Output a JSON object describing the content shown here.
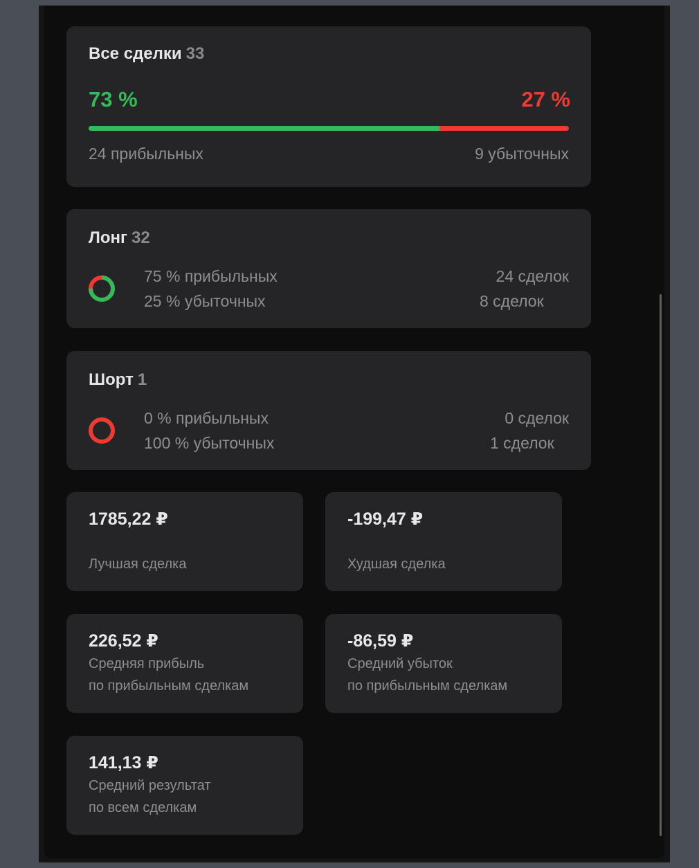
{
  "all_deals": {
    "title": "Все сделки",
    "count": "33",
    "profit_pct_label": "73 %",
    "loss_pct_label": "27 %",
    "profit_fraction": 0.73,
    "profit_label": "24 прибыльных",
    "loss_label": "9 убыточных",
    "colors": {
      "profit": "#33bb5a",
      "loss": "#ee3b32"
    }
  },
  "long": {
    "title": "Лонг",
    "count": "32",
    "profit_line": "75 % прибыльных",
    "loss_line": "25 % убыточных",
    "profit_deals": "24 сделок",
    "loss_deals": "8 сделок",
    "profit_fraction": 0.75,
    "icon": "donut-chart-icon"
  },
  "short": {
    "title": "Шорт",
    "count": "1",
    "profit_line": "0 % прибыльных",
    "loss_line": "100 % убыточных",
    "profit_deals": "0 сделок",
    "loss_deals": "1 сделок",
    "profit_fraction": 0.0,
    "icon": "donut-chart-icon"
  },
  "stats": {
    "best": {
      "value": "1785,22 ₽",
      "label": "Лучшая сделка"
    },
    "worst": {
      "value": "-199,47 ₽",
      "label": "Худшая сделка"
    },
    "avg_profit": {
      "value": "226,52 ₽",
      "label1": "Средняя прибыль",
      "label2": "по прибыльным сделкам"
    },
    "avg_loss": {
      "value": "-86,59 ₽",
      "label1": "Средний убыток",
      "label2": "по прибыльным сделкам"
    },
    "avg_result": {
      "value": "141,13 ₽",
      "label1": "Средний результат",
      "label2": "по всем сделкам"
    }
  }
}
